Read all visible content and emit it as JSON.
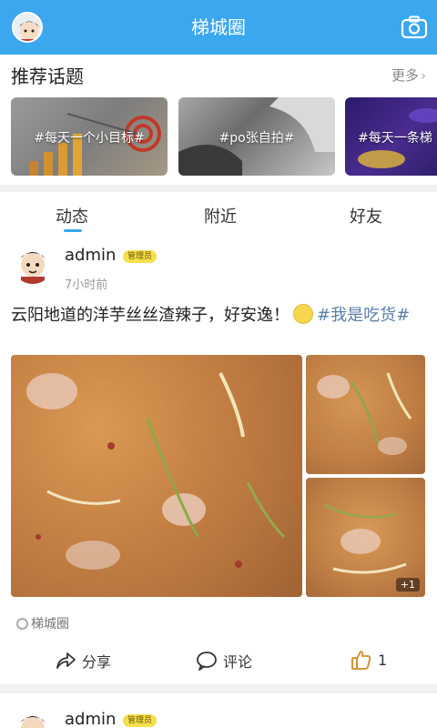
{
  "header": {
    "title": "梯城圈",
    "camera_icon": "camera-icon",
    "bg_color": "#3aa7ee"
  },
  "topics": {
    "title": "推荐话题",
    "more_label": "更多",
    "items": [
      {
        "label": "#每天一个小目标#"
      },
      {
        "label": "#po张自拍#"
      },
      {
        "label": "#每天一条梯"
      }
    ]
  },
  "tabs": [
    {
      "label": "动态",
      "active": true
    },
    {
      "label": "附近",
      "active": false
    },
    {
      "label": "好友",
      "active": false
    }
  ],
  "posts": [
    {
      "author": "admin",
      "badge": "管理员",
      "time": "7小时前",
      "text": "云阳地道的洋芋丝丝渣辣子，好安逸！",
      "tag": "#我是吃货#",
      "extra_images": "+1",
      "circle": "梯城圈",
      "share_label": "分享",
      "comment_label": "评论",
      "like_count": "1"
    },
    {
      "author": "admin",
      "badge": "管理员"
    }
  ]
}
